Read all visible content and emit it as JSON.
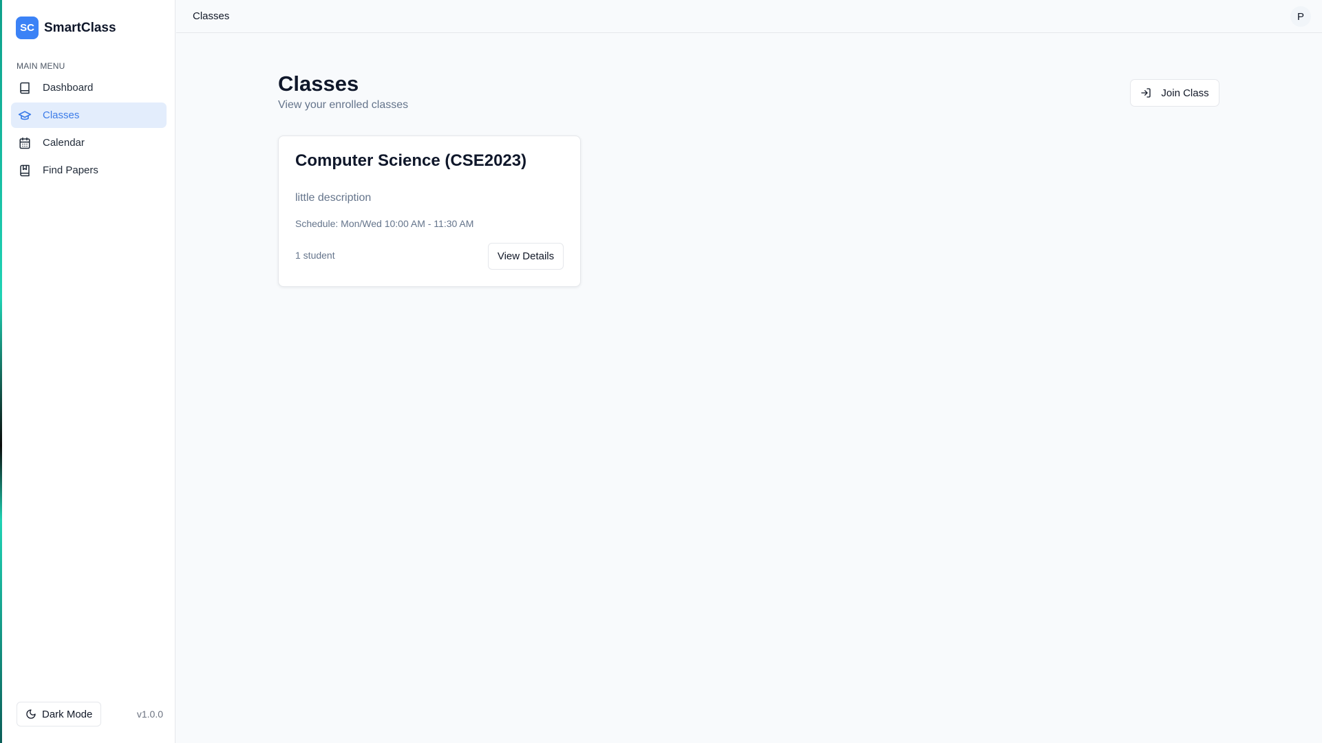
{
  "brand": {
    "logo_text": "SC",
    "name": "SmartClass",
    "accent": "#3b82f6"
  },
  "sidebar": {
    "heading": "MAIN MENU",
    "items": [
      {
        "label": "Dashboard",
        "icon": "book-icon",
        "active": false
      },
      {
        "label": "Classes",
        "icon": "graduation-cap-icon",
        "active": true
      },
      {
        "label": "Calendar",
        "icon": "calendar-icon",
        "active": false
      },
      {
        "label": "Find Papers",
        "icon": "bookmark-book-icon",
        "active": false
      }
    ],
    "footer": {
      "dark_mode_label": "Dark Mode",
      "dark_mode_icon": "moon-icon",
      "version": "v1.0.0"
    }
  },
  "header": {
    "breadcrumb": "Classes",
    "avatar_initial": "P"
  },
  "main": {
    "title": "Classes",
    "subtitle": "View your enrolled classes",
    "join_button_label": "Join Class",
    "join_button_icon": "log-in-icon",
    "classes": [
      {
        "title": "Computer Science (CSE2023)",
        "description": "little description",
        "schedule": "Schedule: Mon/Wed 10:00 AM - 11:30 AM",
        "student_count": "1 student",
        "action_label": "View Details"
      }
    ]
  }
}
